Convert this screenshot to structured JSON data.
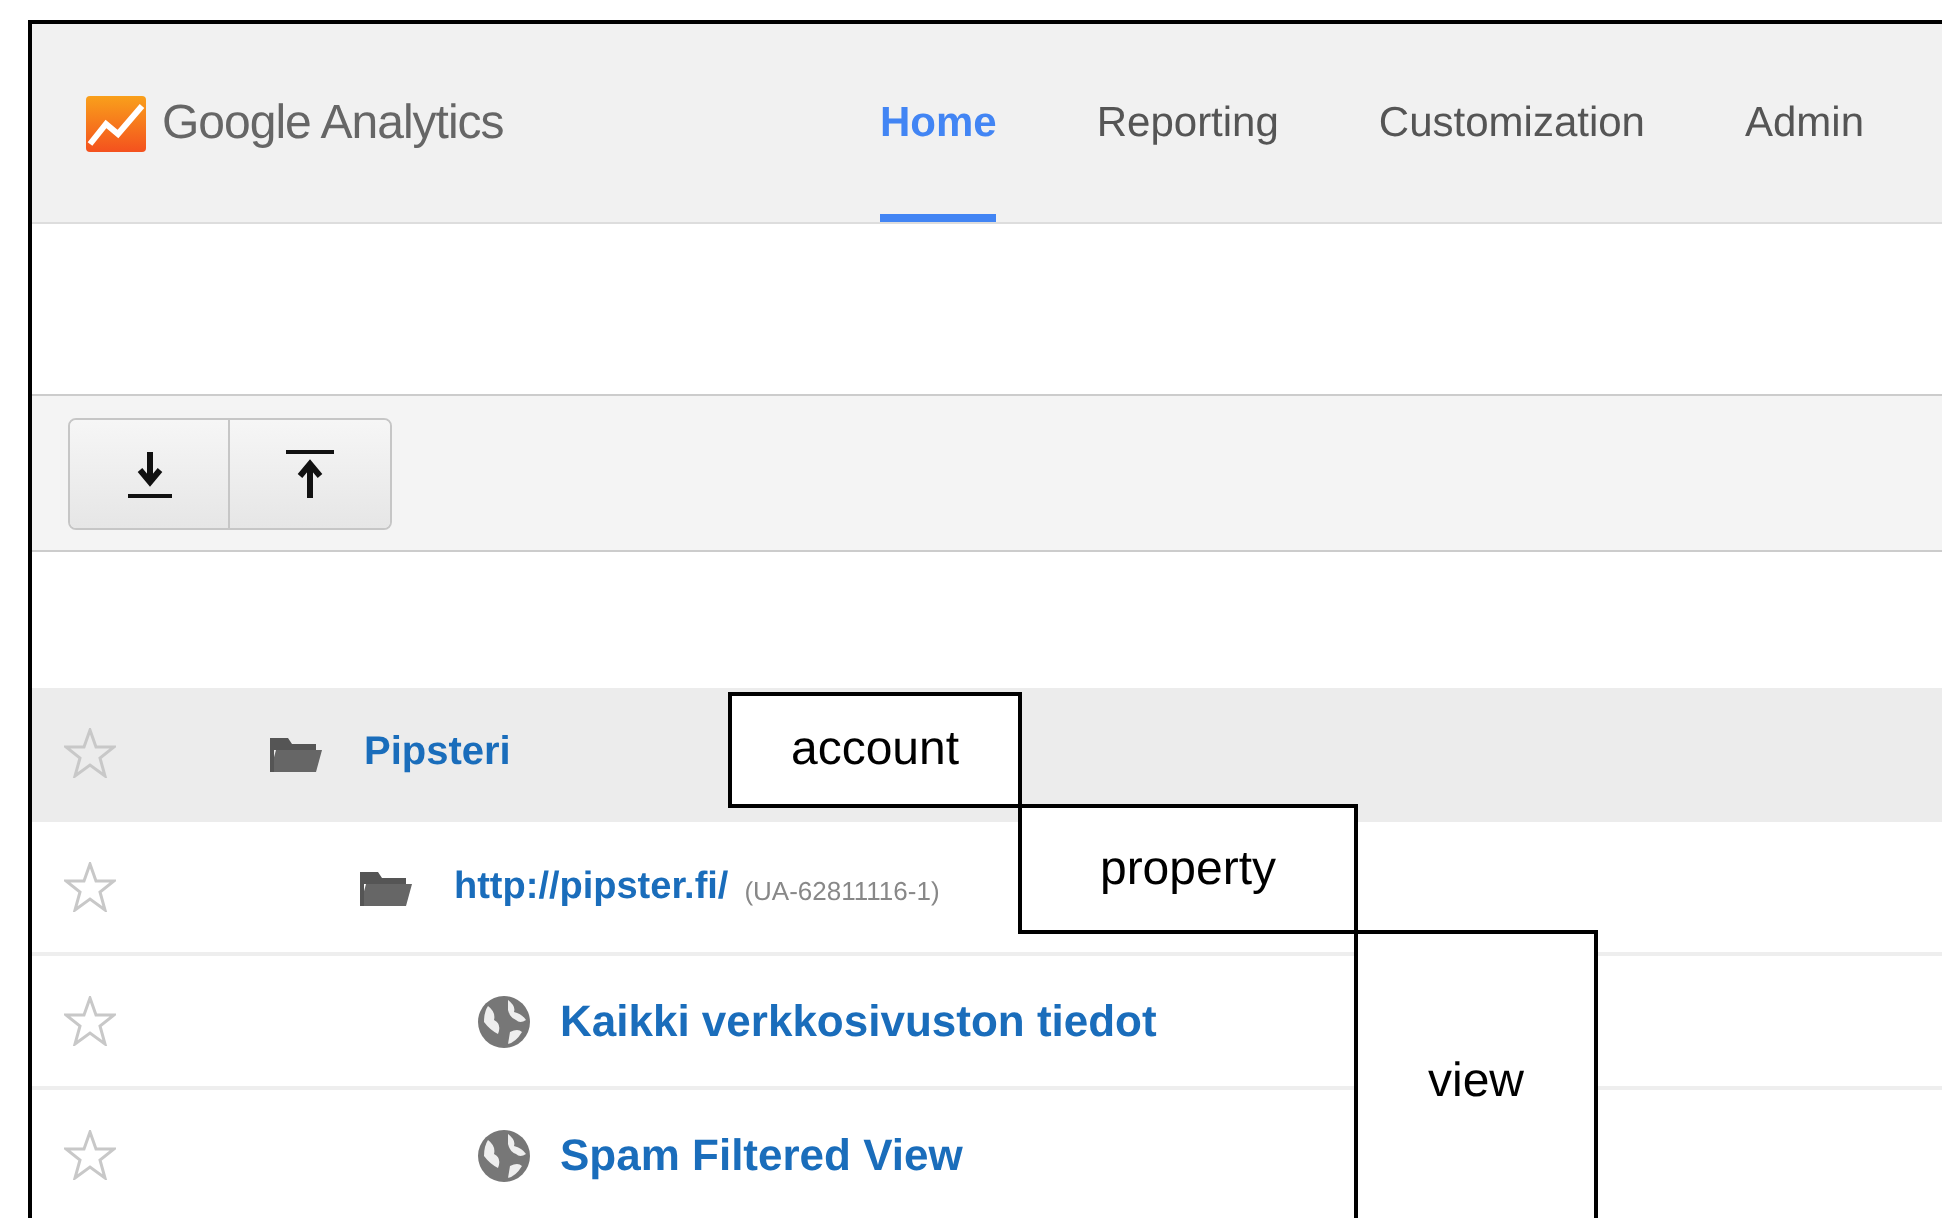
{
  "header": {
    "logo_text": "Google Analytics",
    "tabs": [
      {
        "label": "Home",
        "selected": true
      },
      {
        "label": "Reporting",
        "selected": false
      },
      {
        "label": "Customization",
        "selected": false
      },
      {
        "label": "Admin",
        "selected": false
      }
    ]
  },
  "toolbar": {
    "buttons": [
      {
        "kind": "expand"
      },
      {
        "kind": "collapse"
      }
    ]
  },
  "tree": [
    {
      "kind": "account",
      "name": "Pipsteri",
      "selected": true,
      "children": [
        {
          "kind": "property",
          "name": "http://pipster.fi/",
          "tracking_id": "(UA-62811116-1)",
          "selected": false,
          "children": [
            {
              "kind": "view",
              "name": "Kaikki verkkosivuston tiedot",
              "selected": false
            },
            {
              "kind": "view",
              "name": "Spam Filtered View",
              "selected": false
            }
          ]
        }
      ]
    }
  ],
  "annotations": [
    {
      "label": "account"
    },
    {
      "label": "property"
    },
    {
      "label": "view"
    }
  ]
}
